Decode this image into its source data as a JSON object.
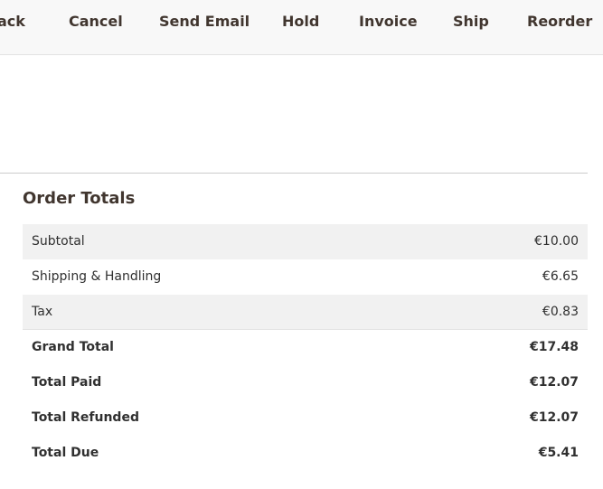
{
  "toolbar": {
    "buttons": [
      {
        "label": "ack"
      },
      {
        "label": "Cancel"
      },
      {
        "label": "Send Email"
      },
      {
        "label": "Hold"
      },
      {
        "label": "Invoice"
      },
      {
        "label": "Ship"
      },
      {
        "label": "Reorder"
      }
    ]
  },
  "order_totals": {
    "title": "Order Totals",
    "rows": [
      {
        "label": "Subtotal",
        "value": "€10.00"
      },
      {
        "label": "Shipping & Handling",
        "value": "€6.65"
      },
      {
        "label": "Tax",
        "value": "€0.83"
      },
      {
        "label": "Grand Total",
        "value": "€17.48"
      },
      {
        "label": "Total Paid",
        "value": "€12.07"
      },
      {
        "label": "Total Refunded",
        "value": "€12.07"
      },
      {
        "label": "Total Due",
        "value": "€5.41"
      }
    ]
  }
}
